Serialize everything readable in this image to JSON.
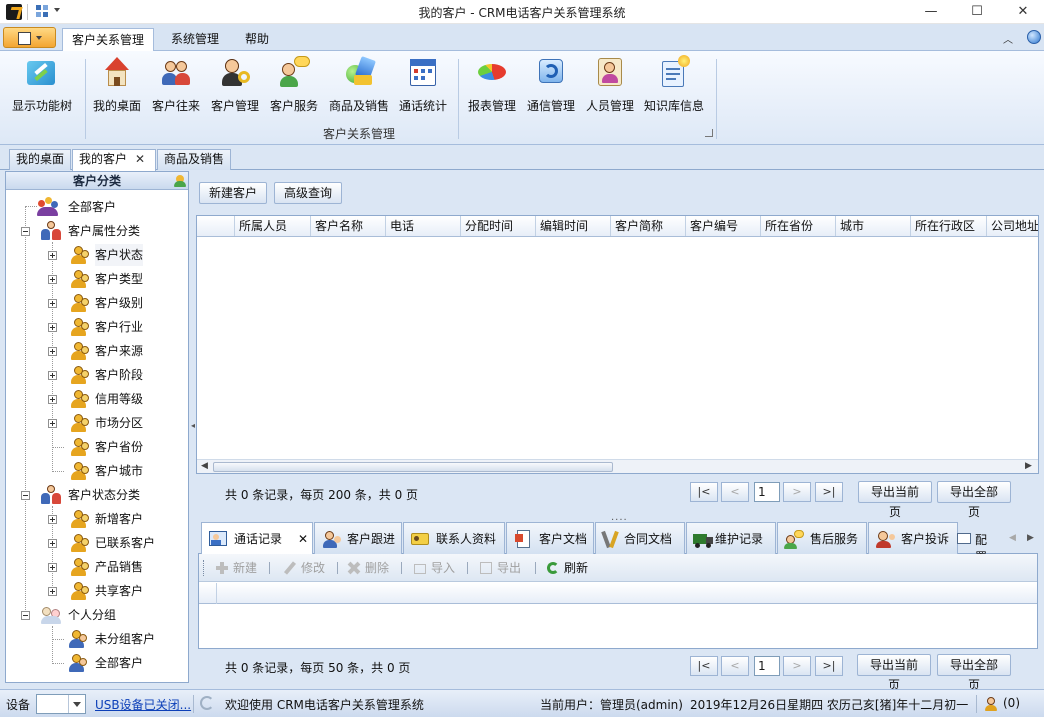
{
  "window": {
    "title": "我的客户 - CRM电话客户关系管理系统",
    "minimize_glyph": "—",
    "maximize_glyph": "☐",
    "close_glyph": "✕"
  },
  "ribbon": {
    "tabs": [
      {
        "label": "客户关系管理",
        "active": true
      },
      {
        "label": "系统管理",
        "active": false
      },
      {
        "label": "帮助",
        "active": false
      }
    ],
    "collapse_glyph": "︿",
    "buttons": [
      {
        "label": "显示功能树",
        "icon": "show-tree-icon"
      },
      {
        "label": "我的桌面",
        "icon": "house-icon"
      },
      {
        "label": "客户往来",
        "icon": "people-icon"
      },
      {
        "label": "客户管理",
        "icon": "person-key-icon"
      },
      {
        "label": "客户服务",
        "icon": "person-chat-icon"
      },
      {
        "label": "商品及销售",
        "icon": "products-icon"
      },
      {
        "label": "通话统计",
        "icon": "calendar-icon"
      },
      {
        "label": "报表管理",
        "icon": "pie-chart-icon"
      },
      {
        "label": "通信管理",
        "icon": "sync-icon"
      },
      {
        "label": "人员管理",
        "icon": "id-card-icon"
      },
      {
        "label": "知识库信息",
        "icon": "knowledge-icon"
      }
    ],
    "group_label": "客户关系管理"
  },
  "doc_tabs": [
    {
      "label": "我的桌面",
      "active": false
    },
    {
      "label": "我的客户",
      "active": true,
      "close": "✕"
    },
    {
      "label": "商品及销售",
      "active": false
    }
  ],
  "left_panel": {
    "title": "客户分类",
    "tree": {
      "all_customers": "全部客户",
      "attr_group": "客户属性分类",
      "attr_items": [
        "客户状态",
        "客户类型",
        "客户级别",
        "客户行业",
        "客户来源",
        "客户阶段",
        "信用等级",
        "市场分区",
        "客户省份",
        "客户城市"
      ],
      "status_group": "客户状态分类",
      "status_items": [
        "新增客户",
        "已联系客户",
        "产品销售",
        "共享客户"
      ],
      "personal_group": "个人分组",
      "personal_items": [
        "未分组客户",
        "全部客户"
      ]
    }
  },
  "main": {
    "new_customer": "新建客户",
    "advanced_search": "高级查询",
    "columns": [
      "所属人员",
      "客户名称",
      "电话",
      "分配时间",
      "编辑时间",
      "客户简称",
      "客户编号",
      "所在省份",
      "城市",
      "所在行政区",
      "公司地址"
    ],
    "pager": {
      "summary": "共 0 条记录，每页 200 条，共 0 页",
      "page": "1",
      "first": "|<",
      "prev": "<",
      "next": ">",
      "last": ">|",
      "export_current": "导出当前页",
      "export_all": "导出全部页"
    }
  },
  "detail": {
    "tabs": [
      {
        "label": "通话记录",
        "active": true,
        "close": "✕"
      },
      {
        "label": "客户跟进"
      },
      {
        "label": "联系人资料"
      },
      {
        "label": "客户文档"
      },
      {
        "label": "合同文档"
      },
      {
        "label": "维护记录"
      },
      {
        "label": "售后服务"
      },
      {
        "label": "客户投诉"
      }
    ],
    "config": "配置",
    "toolbar": {
      "new": "新建",
      "edit": "修改",
      "delete": "删除",
      "import": "导入",
      "export": "导出",
      "refresh": "刷新"
    },
    "pager": {
      "summary": "共 0 条记录，每页 50 条，共 0 页",
      "page": "1",
      "export_current": "导出当前页",
      "export_all": "导出全部页"
    }
  },
  "status": {
    "device_label": "设备",
    "usb": "USB设备已关闭...",
    "welcome": "欢迎使用 CRM电话客户关系管理系统",
    "current_user": "当前用户：管理员(admin)",
    "date": "2019年12月26日星期四 农历己亥[猪]年十二月初一",
    "count": "(0)"
  }
}
